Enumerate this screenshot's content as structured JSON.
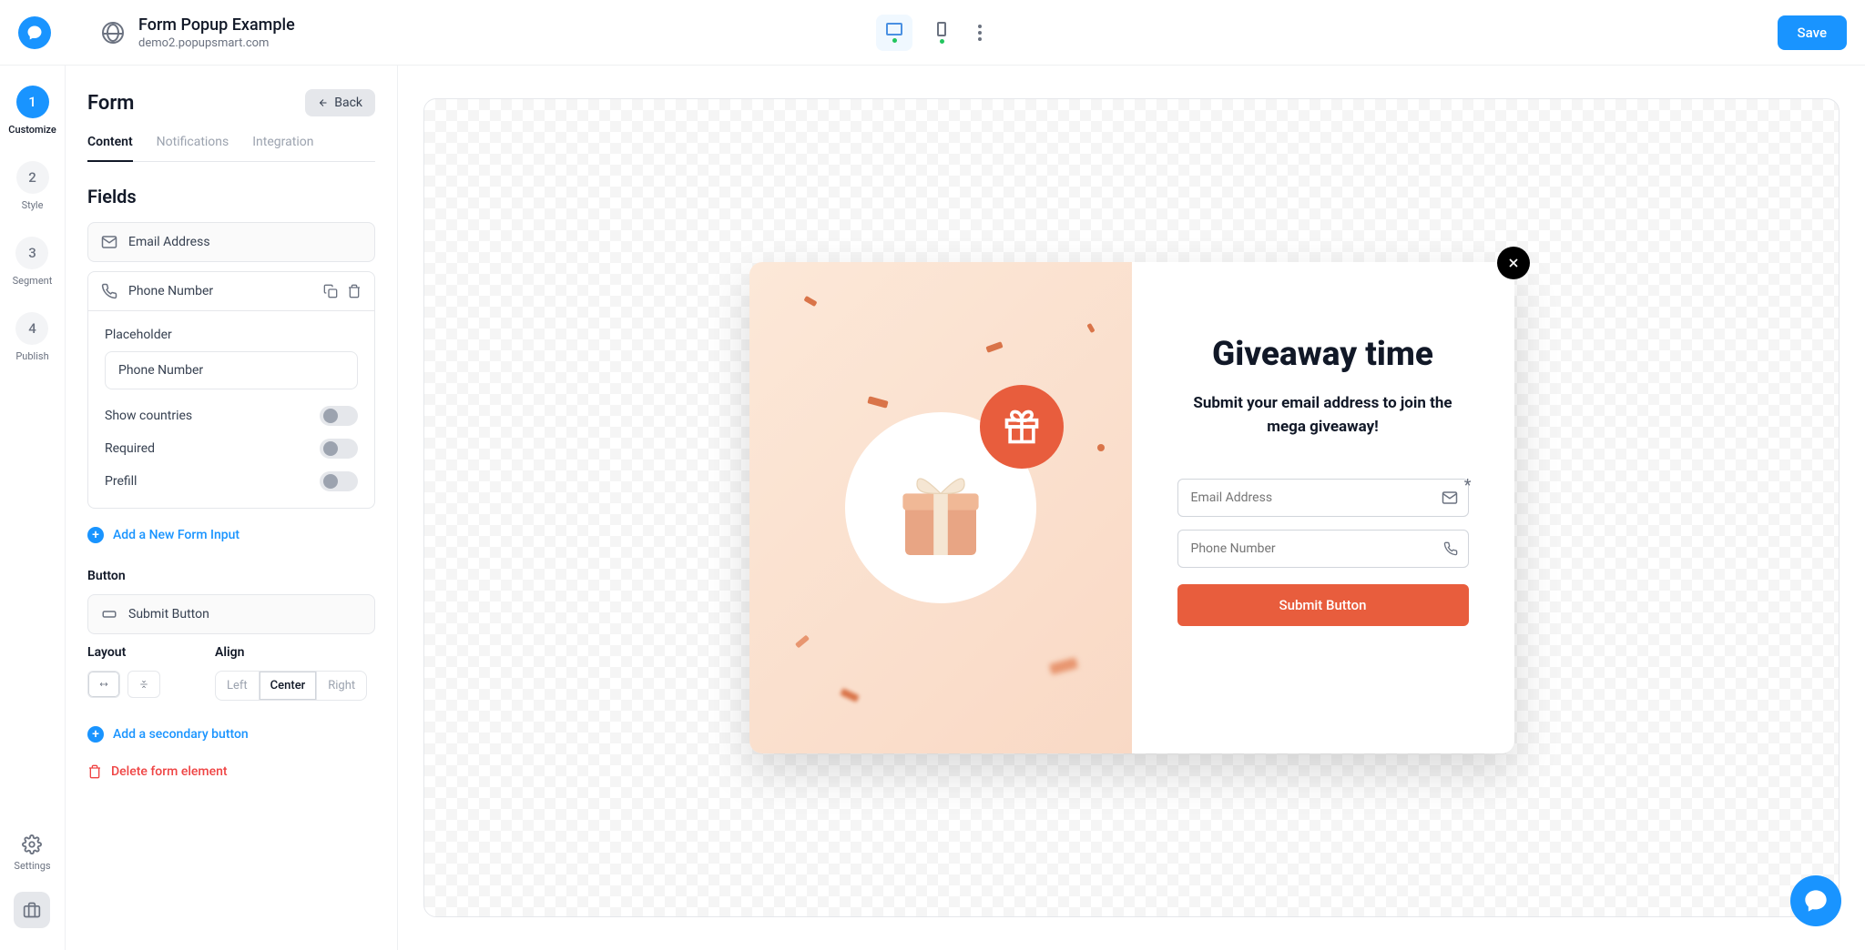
{
  "topbar": {
    "title": "Form Popup Example",
    "subtitle": "demo2.popupsmart.com",
    "save": "Save"
  },
  "rail": {
    "steps": [
      {
        "num": "1",
        "label": "Customize"
      },
      {
        "num": "2",
        "label": "Style"
      },
      {
        "num": "3",
        "label": "Segment"
      },
      {
        "num": "4",
        "label": "Publish"
      }
    ],
    "settings": "Settings"
  },
  "panel": {
    "title": "Form",
    "back": "Back",
    "tabs": {
      "content": "Content",
      "notifications": "Notifications",
      "integration": "Integration"
    },
    "fields_title": "Fields",
    "fields": {
      "email": "Email Address",
      "phone": "Phone Number"
    },
    "phone_edit": {
      "placeholder_label": "Placeholder",
      "placeholder_value": "Phone Number",
      "show_countries": "Show countries",
      "required": "Required",
      "prefill": "Prefill"
    },
    "add_input": "Add a New Form Input",
    "button_section": "Button",
    "submit_button": "Submit Button",
    "layout_label": "Layout",
    "align_label": "Align",
    "align": {
      "left": "Left",
      "center": "Center",
      "right": "Right"
    },
    "add_secondary": "Add a secondary button",
    "delete": "Delete form element"
  },
  "popup": {
    "title": "Giveaway time",
    "subtitle": "Submit your email address to join the mega giveaway!",
    "email_placeholder": "Email Address",
    "phone_placeholder": "Phone Number",
    "submit": "Submit Button"
  }
}
